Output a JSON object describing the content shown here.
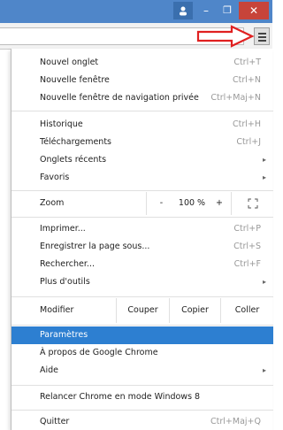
{
  "titlebar": {
    "user_icon": "user-icon",
    "minimize_glyph": "–",
    "maximize_glyph": "❐",
    "close_glyph": "✕"
  },
  "toolbar": {
    "menu_icon": "hamburger-menu-icon"
  },
  "menu": {
    "items": [
      {
        "label": "Nouvel onglet",
        "shortcut": "Ctrl+T"
      },
      {
        "label": "Nouvelle fenêtre",
        "shortcut": "Ctrl+N"
      },
      {
        "label": "Nouvelle fenêtre de navigation privée",
        "shortcut": "Ctrl+Maj+N"
      },
      {
        "label": "Historique",
        "shortcut": "Ctrl+H"
      },
      {
        "label": "Téléchargements",
        "shortcut": "Ctrl+J"
      },
      {
        "label": "Onglets récents",
        "submenu": "▸"
      },
      {
        "label": "Favoris",
        "submenu": "▸"
      },
      {
        "label": "Imprimer...",
        "shortcut": "Ctrl+P"
      },
      {
        "label": "Enregistrer la page sous...",
        "shortcut": "Ctrl+S"
      },
      {
        "label": "Rechercher...",
        "shortcut": "Ctrl+F"
      },
      {
        "label": "Plus d'outils",
        "submenu": "▸"
      },
      {
        "label": "Paramètres"
      },
      {
        "label": "À propos de Google Chrome"
      },
      {
        "label": "Aide",
        "submenu": "▸"
      },
      {
        "label": "Relancer Chrome en mode Windows 8"
      },
      {
        "label": "Quitter",
        "shortcut": "Ctrl+Maj+Q"
      }
    ],
    "zoom": {
      "label": "Zoom",
      "minus": "-",
      "value": "100 %",
      "plus": "+",
      "fullscreen_glyph": "⛶"
    },
    "edit": {
      "label": "Modifier",
      "cut": "Couper",
      "copy": "Copier",
      "paste": "Coller"
    }
  },
  "colors": {
    "selected": "#2d7fd1",
    "titlebar": "#4f86c9",
    "close": "#c7443a",
    "arrow": "#e02020"
  }
}
